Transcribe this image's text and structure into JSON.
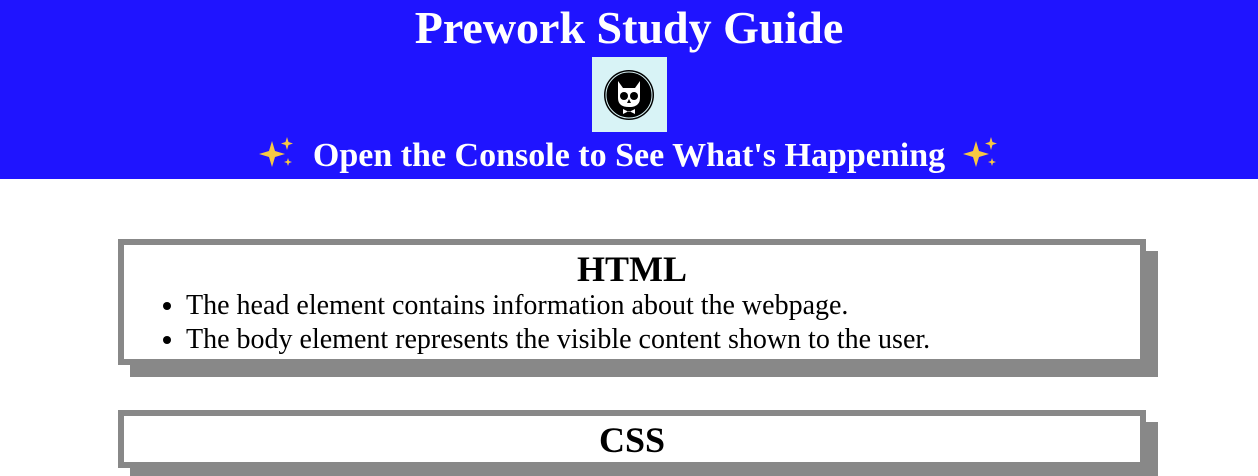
{
  "header": {
    "title": "Prework Study Guide",
    "subtitle": "Open the Console to See What's Happening",
    "logo_icon": "cat-skull-logo-icon",
    "sparkle_icon": "sparkles-icon",
    "background_color": "#1f14ff"
  },
  "sections": [
    {
      "title": "HTML",
      "items": [
        "The head element contains information about the webpage.",
        "The body element represents the visible content shown to the user."
      ]
    },
    {
      "title": "CSS",
      "items": []
    }
  ]
}
